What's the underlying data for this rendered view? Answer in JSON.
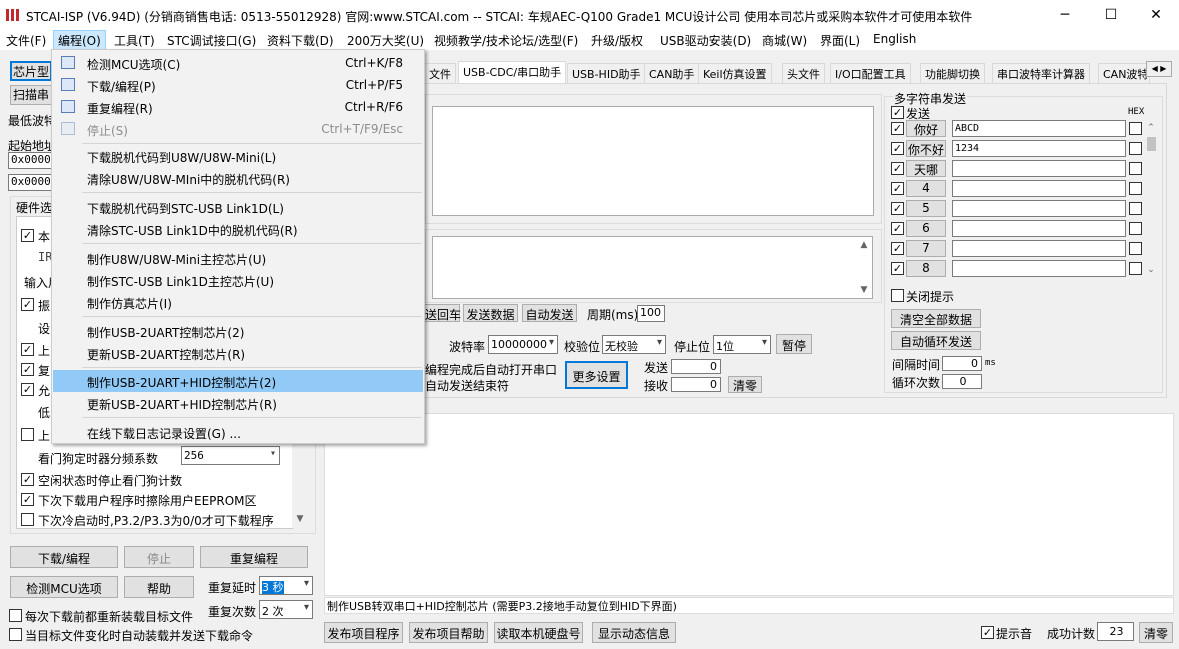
{
  "window": {
    "title": "STCAI-ISP (V6.94D) (分销商销售电话: 0513-55012928) 官网:www.STCAI.com  -- STCAI: 车规AEC-Q100 Grade1 MCU设计公司 使用本司芯片或采购本软件才可使用本软件",
    "minimize": "─",
    "maximize": "☐",
    "close": "✕"
  },
  "menubar": [
    "文件(F)",
    "编程(O)",
    "工具(T)",
    "STC调试接口(G)",
    "资料下载(D)",
    "200万大奖(U)",
    "视频教学/技术论坛/选型(F)",
    "升级/版权",
    "USB驱动安装(D)",
    "商城(W)",
    "界面(L)",
    "English"
  ],
  "dropdown": {
    "items": [
      {
        "label": "检测MCU选项(C)",
        "shortcut": "Ctrl+K/F8"
      },
      {
        "label": "下载/编程(P)",
        "shortcut": "Ctrl+P/F5"
      },
      {
        "label": "重复编程(R)",
        "shortcut": "Ctrl+R/F6"
      },
      {
        "label": "停止(S)",
        "shortcut": "Ctrl+T/F9/Esc"
      },
      {
        "label": "下载脱机代码到U8W/U8W-Mini(L)"
      },
      {
        "label": "清除U8W/U8W-MIni中的脱机代码(R)"
      },
      {
        "label": "下载脱机代码到STC-USB Link1D(L)"
      },
      {
        "label": "清除STC-USB Link1D中的脱机代码(R)"
      },
      {
        "label": "制作U8W/U8W-Mini主控芯片(U)"
      },
      {
        "label": "制作STC-USB Link1D主控芯片(U)"
      },
      {
        "label": "制作仿真芯片(I)"
      },
      {
        "label": "制作USB-2UART控制芯片(2)"
      },
      {
        "label": "更新USB-2UART控制芯片(R)"
      },
      {
        "label": "制作USB-2UART+HID控制芯片(2)"
      },
      {
        "label": "更新USB-2UART+HID控制芯片(R)"
      },
      {
        "label": "在线下载日志记录设置(G) ..."
      }
    ]
  },
  "left": {
    "chip_btn": "芯片型",
    "scan_btn": "扫描串",
    "min_baud": "最低波特",
    "start_addr": "起始地址",
    "addr1": "0x0000",
    "addr2": "0x0000",
    "hw_tab": "硬件选",
    "opt_frag": [
      "本",
      "IR",
      "输入用",
      "振",
      "设",
      "上",
      "复",
      "允",
      "低",
      "上"
    ],
    "watchdog_label": "看门狗定时器分频系数",
    "watchdog_value": "256",
    "opt_idle": "空闲状态时停止看门狗计数",
    "opt_eeprom": "下次下载用户程序时擦除用户EEPROM区",
    "opt_p32": "下次冷启动时,P3.2/P3.3为0/0才可下载程序",
    "btn_download": "下载/编程",
    "btn_stop": "停止",
    "btn_repeat": "重复编程",
    "btn_check": "检测MCU选项",
    "btn_help": "帮助",
    "delay_label": "重复延时",
    "delay_value": "3 秒",
    "count_label": "重复次数",
    "count_value": "2 次",
    "chk_reload": "每次下载前都重新装载目标文件",
    "chk_auto": "当目标文件变化时自动装载并发送下载命令"
  },
  "tabs": [
    "文件",
    "USB-CDC/串口助手",
    "USB-HID助手",
    "CAN助手",
    "Keil仿真设置",
    "头文件",
    "I/O口配置工具",
    "功能脚切换",
    "串口波特率计算器",
    "CAN波特"
  ],
  "serial": {
    "send_loop": "送回车",
    "send_data": "发送数据",
    "auto_send": "自动发送",
    "period_label": "周期(ms)",
    "period_value": "100",
    "baud_label": "波特率",
    "baud_value": "10000000",
    "parity_label": "校验位",
    "parity_value": "无校验",
    "stop_label": "停止位",
    "stop_value": "1位",
    "pause": "暂停",
    "auto_open": "编程完成后自动打开串口",
    "auto_end": "自动发送结束符",
    "more": "更多设置",
    "send_count_label": "发送",
    "send_count": "0",
    "recv_count_label": "接收",
    "recv_count": "0",
    "clear": "清零"
  },
  "multi": {
    "title": "多字符串发送",
    "send_header": "发送",
    "hex_header": "HEX",
    "rows": [
      {
        "btn": "你好",
        "value": "ABCD"
      },
      {
        "btn": "你不好",
        "value": "1234"
      },
      {
        "btn": "天哪",
        "value": ""
      },
      {
        "btn": "4",
        "value": ""
      },
      {
        "btn": "5",
        "value": ""
      },
      {
        "btn": "6",
        "value": ""
      },
      {
        "btn": "7",
        "value": ""
      },
      {
        "btn": "8",
        "value": ""
      }
    ],
    "close_tip": "关闭提示",
    "clear_all": "清空全部数据",
    "auto_loop": "自动循环发送",
    "interval_label": "间隔时间",
    "interval_value": "0",
    "interval_unit": "ms",
    "loop_label": "循环次数",
    "loop_value": "0"
  },
  "status": {
    "message": "制作USB转双串口+HID控制芯片 (需要P3.2接地手动复位到HID下界面)",
    "publish_prog": "发布项目程序",
    "publish_help": "发布项目帮助",
    "read_disk": "读取本机硬盘号",
    "show_info": "显示动态信息",
    "beep": "提示音",
    "success_label": "成功计数",
    "success_value": "23",
    "clear": "清零"
  },
  "colors": {
    "highlight": "#91c9f7",
    "menu_active": "#cce8ff",
    "focus_border": "#0078d7",
    "logo": "#c0282d"
  }
}
